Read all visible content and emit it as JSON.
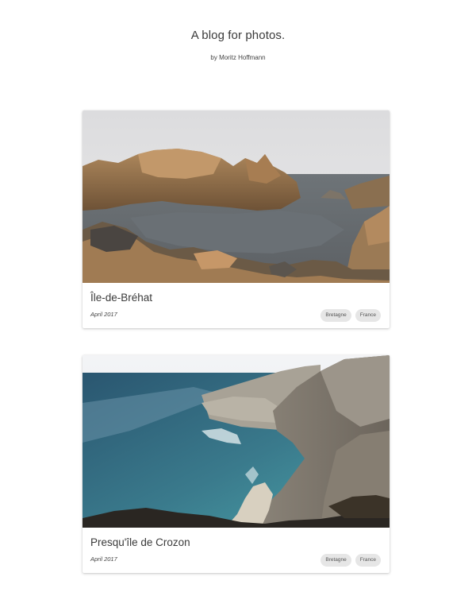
{
  "header": {
    "title": "A blog for photos.",
    "author": "by Moritz Hoffmann"
  },
  "posts": [
    {
      "title": "Île-de-Bréhat",
      "date": "April 2017",
      "tags": [
        "Bretagne",
        "France"
      ]
    },
    {
      "title": "Presqu'île de Crozon",
      "date": "April 2017",
      "tags": [
        "Bretagne",
        "France"
      ]
    }
  ]
}
